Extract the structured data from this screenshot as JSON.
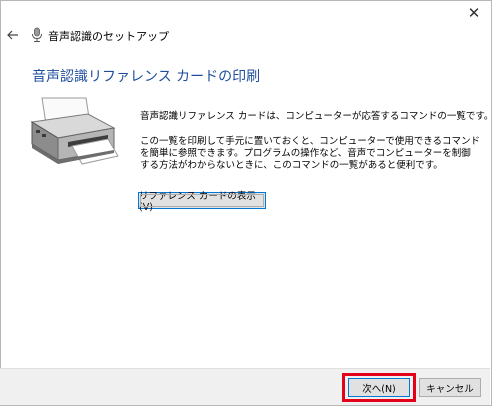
{
  "window": {
    "close_symbol": "✕"
  },
  "header": {
    "title": "音声認識のセットアップ",
    "back_icon": "arrow-left-icon",
    "app_icon": "microphone-icon"
  },
  "main": {
    "heading": "音声認識リファレンス カードの印刷",
    "description_line1": "音声認識リファレンス カードは、コンピューターが応答するコマンドの一覧です。",
    "description_para2": "この一覧を印刷して手元に置いておくと、コンピューターで使用できるコマンドを簡単に参照できます。プログラムの操作など、音声でコンピューターを制御する方法がわからないときに、このコマンドの一覧があると便利です。",
    "show_reference_button": "リファレンス カードの表示(V)",
    "illustration_icon": "printer-icon"
  },
  "footer": {
    "next_button": "次へ(N)",
    "cancel_button": "キャンセル"
  },
  "colors": {
    "heading": "#1e4e9c",
    "highlight": "#e3001b",
    "button_focus_border": "#0078d7",
    "footer_bg": "#f0f0f0"
  }
}
